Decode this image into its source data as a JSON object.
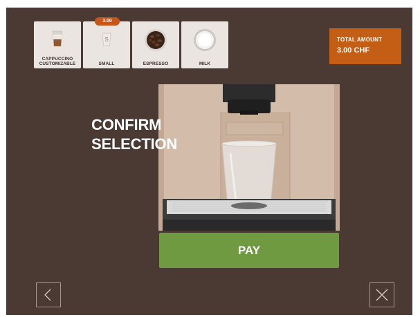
{
  "selection": {
    "items": [
      {
        "label_line1": "CAPPUCCINO",
        "label_line2": "CUSTOMIZABLE",
        "icon": "cappuccino-glass-icon"
      },
      {
        "label_line1": "SMALL",
        "label_line2": "",
        "icon": "small-cup-icon"
      },
      {
        "label_line1": "ESPRESSO",
        "label_line2": "",
        "icon": "coffee-beans-icon"
      },
      {
        "label_line1": "MILK",
        "label_line2": "",
        "icon": "milk-bowl-icon"
      }
    ],
    "size_price": "3.00"
  },
  "total": {
    "label": "TOTAL AMOUNT",
    "value": "3.00 CHF"
  },
  "headline": {
    "line1": "CONFIRM",
    "line2": "SELECTION"
  },
  "pay_label": "PAY",
  "nav": {
    "back_icon": "chevron-left-icon",
    "close_icon": "close-icon"
  },
  "colors": {
    "background": "#4b3a33",
    "accent": "#c45e14",
    "pay": "#6f9a41"
  }
}
